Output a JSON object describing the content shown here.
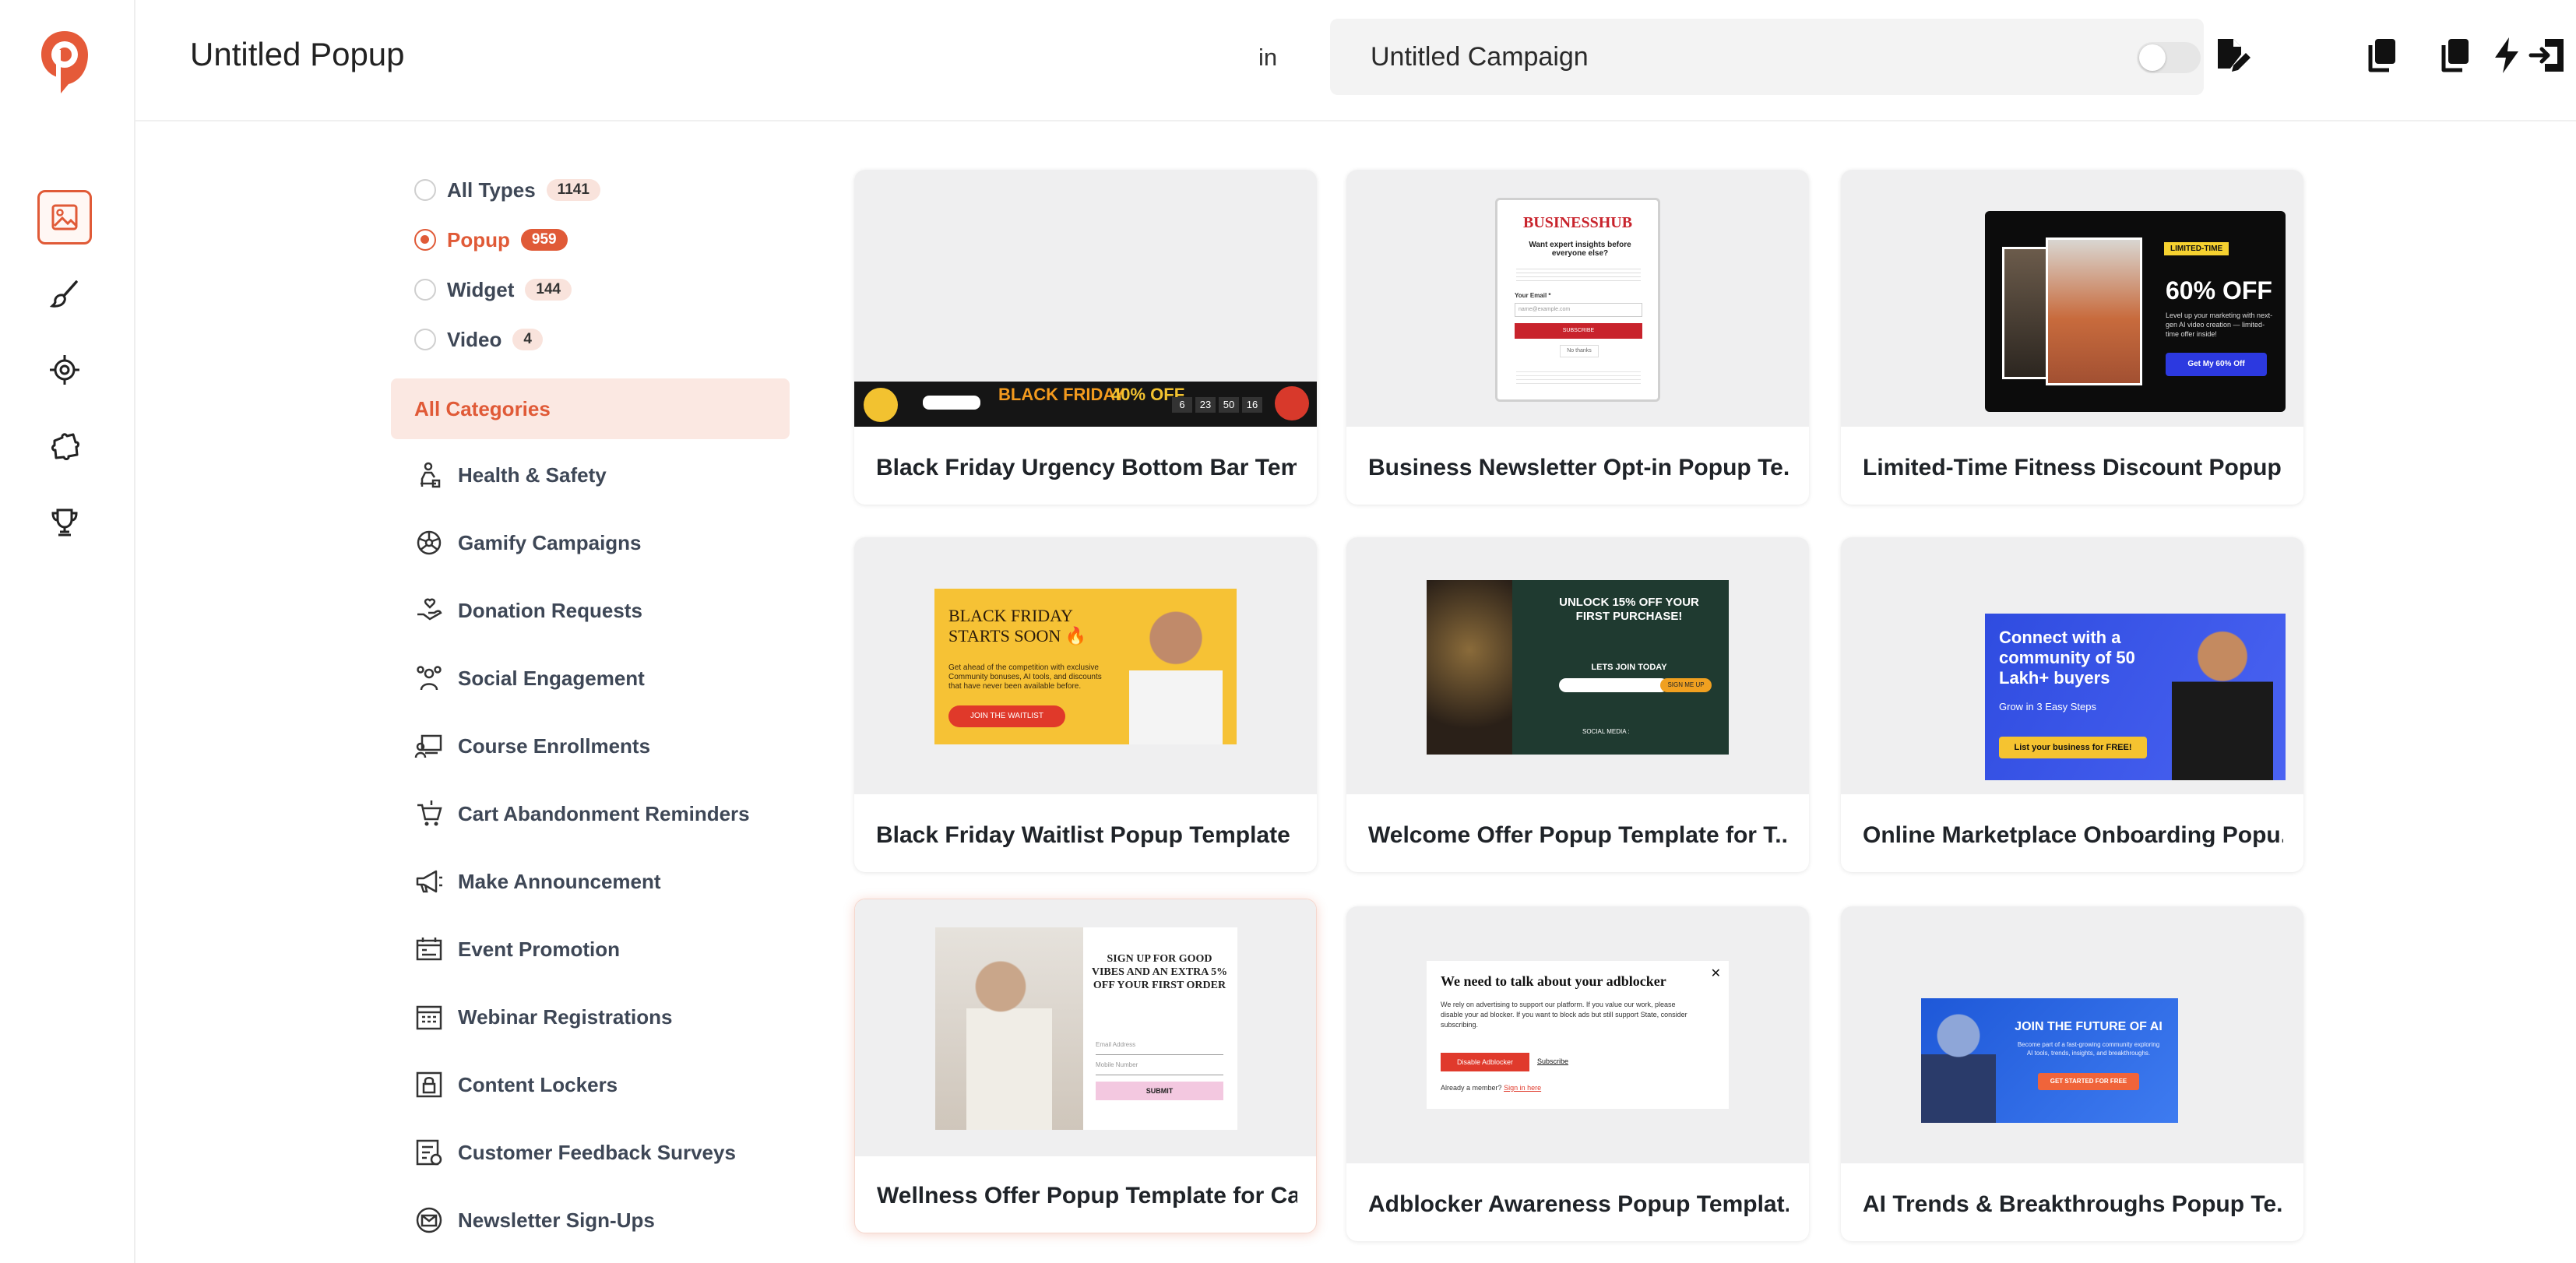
{
  "header": {
    "popup_title": "Untitled Popup",
    "in_label": "in",
    "campaign_name": "Untitled Campaign"
  },
  "rail": {
    "items": [
      {
        "icon": "image-icon",
        "active": true
      },
      {
        "icon": "brush-icon",
        "active": false
      },
      {
        "icon": "target-icon",
        "active": false
      },
      {
        "icon": "puzzle-icon",
        "active": false
      },
      {
        "icon": "trophy-icon",
        "active": false
      }
    ]
  },
  "types": [
    {
      "label": "All Types",
      "count": "1141",
      "checked": false
    },
    {
      "label": "Popup",
      "count": "959",
      "checked": true
    },
    {
      "label": "Widget",
      "count": "144",
      "checked": false
    },
    {
      "label": "Video",
      "count": "4",
      "checked": false
    }
  ],
  "categories": {
    "all_label": "All Categories",
    "items": [
      {
        "label": "Health & Safety",
        "icon": "health-icon"
      },
      {
        "label": "Gamify Campaigns",
        "icon": "wheel-icon"
      },
      {
        "label": "Donation Requests",
        "icon": "donation-icon"
      },
      {
        "label": "Social Engagement",
        "icon": "social-icon"
      },
      {
        "label": "Course Enrollments",
        "icon": "course-icon"
      },
      {
        "label": "Cart Abandonment Reminders",
        "icon": "cart-icon"
      },
      {
        "label": "Make Announcement",
        "icon": "megaphone-icon"
      },
      {
        "label": "Event Promotion",
        "icon": "event-icon"
      },
      {
        "label": "Webinar Registrations",
        "icon": "calendar-icon"
      },
      {
        "label": "Content Lockers",
        "icon": "lock-icon"
      },
      {
        "label": "Customer Feedback Surveys",
        "icon": "survey-icon"
      },
      {
        "label": "Newsletter Sign-Ups",
        "icon": "mail-icon"
      }
    ]
  },
  "templates": [
    {
      "title": "Black Friday Urgency Bottom Bar Tem..."
    },
    {
      "title": "Business Newsletter Opt-in Popup Te..."
    },
    {
      "title": "Limited-Time Fitness Discount Popup ..."
    },
    {
      "title": "Black Friday Waitlist Popup Template ..."
    },
    {
      "title": "Welcome Offer Popup Template for T..."
    },
    {
      "title": "Online Marketplace Onboarding Popu..."
    },
    {
      "title": "Wellness Offer Popup Template for Ca..."
    },
    {
      "title": "Adblocker Awareness Popup Templat..."
    },
    {
      "title": "AI Trends & Breakthroughs Popup Te..."
    }
  ],
  "previews": {
    "bf_bar": {
      "headline": "BLACK FRIDAY",
      "percent": "40% OFF",
      "countdown": [
        "6",
        "23",
        "50",
        "16"
      ]
    },
    "bizhub": {
      "brand": "BUSINESSHUB",
      "headline": "Want expert insights before everyone else?",
      "email_label": "Your Email *",
      "email_placeholder": "name@example.com",
      "cta": "SUBSCRIBE",
      "secondary": "No thanks"
    },
    "fitness": {
      "badge": "LIMITED-TIME",
      "headline": "60% OFF",
      "body": "Level up your marketing with next-gen AI video creation — limited-time offer inside!",
      "cta": "Get My 60% Off"
    },
    "bf_waitlist": {
      "headline": "BLACK FRIDAY STARTS SOON 🔥",
      "body": "Get ahead of the competition with exclusive Community bonuses, AI tools, and discounts that have never been available before.",
      "cta": "JOIN THE WAITLIST"
    },
    "welcome": {
      "headline": "UNLOCK 15% OFF YOUR FIRST PURCHASE!",
      "sub": "LETS JOIN TODAY",
      "cta": "SIGN ME UP",
      "social": "SOCIAL MEDIA :"
    },
    "marketplace": {
      "headline": "Connect with a community of 50 Lakh+ buyers",
      "sub": "Grow in 3 Easy Steps",
      "cta": "List your business for FREE!"
    },
    "wellness": {
      "headline": "SIGN UP FOR GOOD VIBES AND AN EXTRA 5% OFF YOUR FIRST ORDER",
      "email": "Email Address",
      "mobile": "Mobile Number",
      "cta": "SUBMIT"
    },
    "adblock": {
      "headline": "We need to talk about your adblocker",
      "body": "We rely on advertising to support our platform. If you value our work, please disable your ad blocker. If you want to block ads but still support State, consider subscribing.",
      "cta": "Disable Adblocker",
      "link": "Subscribe",
      "member": "Already a member?",
      "signin": "Sign in here"
    },
    "ai": {
      "headline": "JOIN THE FUTURE OF AI",
      "body": "Become part of a fast-growing community exploring AI tools, trends, insights, and breakthroughs.",
      "cta": "GET STARTED FOR FREE"
    }
  },
  "colors": {
    "accent": "#e05a37",
    "accent_soft": "#fbe8e2",
    "text": "#3e4756"
  }
}
